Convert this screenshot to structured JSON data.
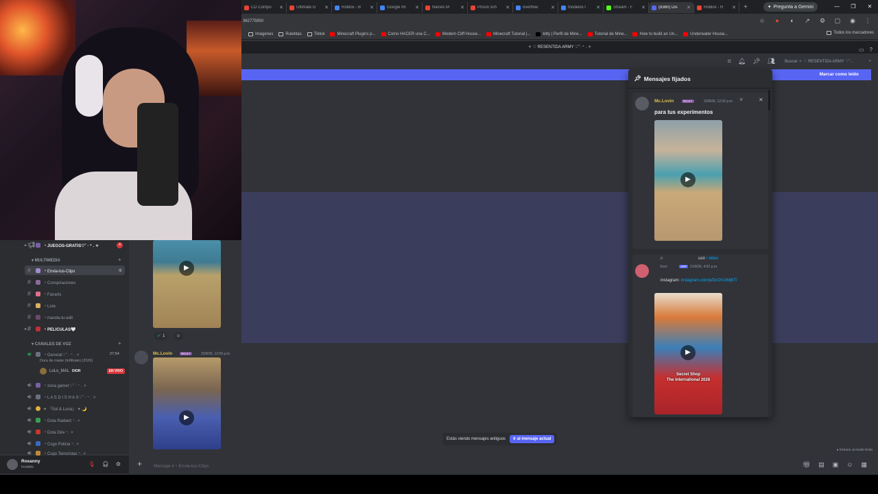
{
  "browser": {
    "tabs": [
      {
        "label": "CD Compo",
        "color": "#ea4335"
      },
      {
        "label": "Ultimate G",
        "color": "#ea4335"
      },
      {
        "label": "Roblox - B",
        "color": "#4285f4"
      },
      {
        "label": "Google Im",
        "color": "#4285f4"
      },
      {
        "label": "Nieces M",
        "color": "#ea4335"
      },
      {
        "label": "Prison sch",
        "color": "#ea4335"
      },
      {
        "label": "overflow",
        "color": "#4285f4"
      },
      {
        "label": "modelos l",
        "color": "#4285f4"
      },
      {
        "label": "Stream - F",
        "color": "#53fc18"
      },
      {
        "label": "(8360) Dis",
        "color": "#5865f2",
        "active": true
      },
      {
        "label": "Roblox - R",
        "color": "#ea4335"
      }
    ],
    "gemini_label": "Pregunta a Gemini",
    "url": "362775950",
    "bookmarks": [
      {
        "label": "Imágenes",
        "icon": "folder"
      },
      {
        "label": "Ruletitas",
        "icon": "folder"
      },
      {
        "label": "Tiktok",
        "icon": "folder"
      },
      {
        "label": "Minecraft Plugins p...",
        "icon": "youtube"
      },
      {
        "label": "Como HACER una C...",
        "icon": "youtube"
      },
      {
        "label": "Modern Cliff House...",
        "icon": "youtube"
      },
      {
        "label": "Minecraft Tutorial |...",
        "icon": "youtube"
      },
      {
        "label": "kitty | Perfil de Mine...",
        "icon": "black"
      },
      {
        "label": "Tutorial de Mine...",
        "icon": "youtube"
      },
      {
        "label": "How to build an Un...",
        "icon": "youtube"
      },
      {
        "label": "Underwater House...",
        "icon": "youtube"
      }
    ],
    "bookmarks_all": "Todos los marcadores"
  },
  "discord": {
    "window_title": "✧ ♡ RESENTIDA ARMY ♡˚‧ ⁺ . ✧",
    "search_placeholder": "Buscar ✧ ♡ RESENTIDA ARMY ♡˚..",
    "mark_read": "Marcar como leído",
    "sidebar": {
      "channels_top": [
        {
          "label": "・JUEGOS-GRATIS♡˚ ‧ ⁺ . ✧",
          "type": "text",
          "unread": true,
          "badge": "4"
        }
      ],
      "category_multimedia": "MULTIMEDIA",
      "multimedia_channels": [
        {
          "label": "・Envia-tus-Clips",
          "active": true
        },
        {
          "label": "・Conspiraciones"
        },
        {
          "label": "・Fanarts"
        },
        {
          "label": "・Lore"
        },
        {
          "label": "・manda-tu-edit"
        },
        {
          "label": "・PELICULAS🤍",
          "unread": true
        }
      ],
      "category_voice": "CANALES DE VOZ",
      "voice_channels": [
        {
          "label": "・General♡˚ ‧ ⁺ . ✧",
          "time": "27:54",
          "subtitle": "Dura de matar (Infiltrate) (2026)"
        },
        {
          "label": "・zona gamer♡˚ ‧ ⁺ . ✧"
        },
        {
          "label": "・L A S D I S H A S♡˚ ‧ ⁺ . ✧"
        },
        {
          "label": "✦ 『Sol & Luna』 ✦ 🌙"
        },
        {
          "label": "・Dota Radiant ⁺. ✧"
        },
        {
          "label": "・Dota Dire ⁺. ✧"
        },
        {
          "label": "・Csgo Policia ⁺. ✧"
        },
        {
          "label": "・Csgo Terroristas ⁺. ✧"
        }
      ],
      "live_user": {
        "name": "LoLo_MAL",
        "tag": "DIOR",
        "badge": "EN VIVO"
      }
    },
    "user": {
      "name": "Roxanny",
      "status": "Invisible"
    },
    "messages": [
      {
        "reaction_count": "1"
      },
      {
        "author": "Mc.Lovin",
        "tag": "RICKY",
        "time": "22/8/26, 12:05 p.m."
      }
    ],
    "old_messages_text": "Estás viendo mensajes antiguos",
    "jump_present": "Ir al mensaje actual",
    "composer_placeholder": "Mensaje #・Envia-tus-Clips",
    "slowmode": "Inmune al modo lento",
    "pinned": {
      "title": "Mensajes fijados",
      "items": [
        {
          "author": "Mc.Lovin",
          "tag": "RICKY",
          "time": "22/8/26, 12:02 p.m.",
          "text": "para tus experimentos",
          "jump": "Ir"
        },
        {
          "author": "Jr",
          "subauthor": "Soci",
          "app": "APP",
          "used": "usó",
          "command": "/ video",
          "time": "21/8/26, 4:52 p.m.",
          "link_prefix": "instagram:",
          "link": "instagram.com/p/DcOVJrMj6T/",
          "caption1": "Secret Shop",
          "caption2": "The International 2026"
        }
      ]
    }
  }
}
